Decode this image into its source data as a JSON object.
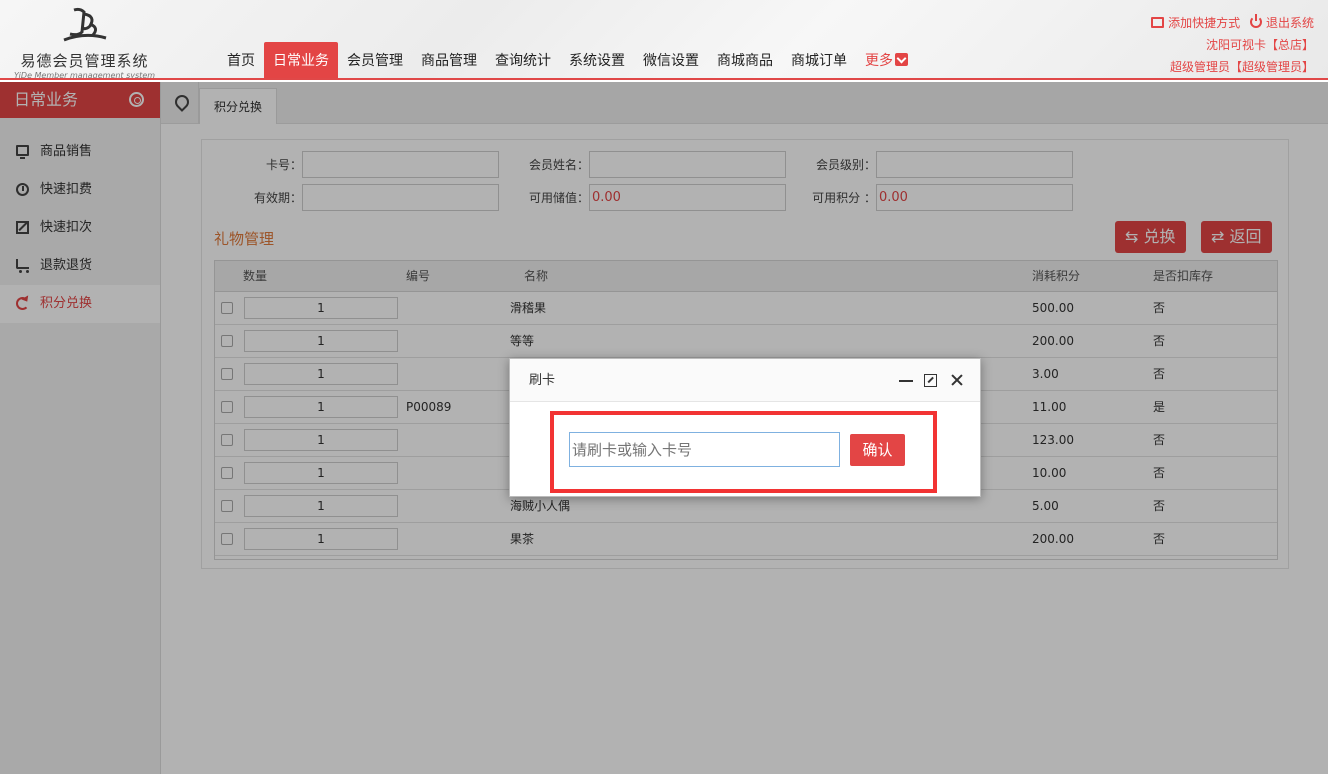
{
  "header": {
    "app_name_cn": "易德会员管理系统",
    "app_name_en": "YiDe Member management system",
    "nav": [
      {
        "label": "首页"
      },
      {
        "label": "日常业务"
      },
      {
        "label": "会员管理"
      },
      {
        "label": "商品管理"
      },
      {
        "label": "查询统计"
      },
      {
        "label": "系统设置"
      },
      {
        "label": "微信设置"
      },
      {
        "label": "商城商品"
      },
      {
        "label": "商城订单"
      },
      {
        "label": "更多"
      }
    ],
    "shortcut_label": "添加快捷方式",
    "logout_label": "退出系统",
    "store_label": "沈阳可视卡【总店】",
    "user_label": "超级管理员【超级管理员】",
    "accent_color": "#e34545"
  },
  "sidebar": {
    "title": "日常业务",
    "items": [
      {
        "label": "商品销售",
        "icon": "monitor-icon"
      },
      {
        "label": "快速扣费",
        "icon": "timer-icon"
      },
      {
        "label": "快速扣次",
        "icon": "edit-icon"
      },
      {
        "label": "退款退货",
        "icon": "cart-icon"
      },
      {
        "label": "积分兑换",
        "icon": "refresh-icon"
      }
    ]
  },
  "tabs": {
    "current": "积分兑换"
  },
  "form": {
    "card_no_label": "卡号：",
    "member_name_label": "会员姓名：",
    "member_level_label": "会员级别：",
    "valid_label": "有效期：",
    "balance_label": "可用储值：",
    "balance_value": "0.00",
    "points_label": "可用积分 ：",
    "points_value": "0.00"
  },
  "gift": {
    "title": "礼物管理",
    "exchange_label": "兑换",
    "back_label": "返回",
    "columns": {
      "qty": "数量",
      "code": "编号",
      "name": "名称",
      "points": "消耗积分",
      "stock": "是否扣库存"
    },
    "rows": [
      {
        "qty": "1",
        "code": "",
        "name": "滑稽果",
        "points": "500.00",
        "stock": "否"
      },
      {
        "qty": "1",
        "code": "",
        "name": "等等",
        "points": "200.00",
        "stock": "否"
      },
      {
        "qty": "1",
        "code": "",
        "name": "",
        "points": "3.00",
        "stock": "否"
      },
      {
        "qty": "1",
        "code": "P00089",
        "name": "",
        "points": "11.00",
        "stock": "是"
      },
      {
        "qty": "1",
        "code": "",
        "name": "",
        "points": "123.00",
        "stock": "否"
      },
      {
        "qty": "1",
        "code": "",
        "name": "",
        "points": "10.00",
        "stock": "否"
      },
      {
        "qty": "1",
        "code": "",
        "name": "海贼小人偶",
        "points": "5.00",
        "stock": "否"
      },
      {
        "qty": "1",
        "code": "",
        "name": "果茶",
        "points": "200.00",
        "stock": "否"
      }
    ]
  },
  "dialog": {
    "title": "刷卡",
    "input_placeholder": "请刷卡或输入卡号",
    "confirm_label": "确认"
  }
}
